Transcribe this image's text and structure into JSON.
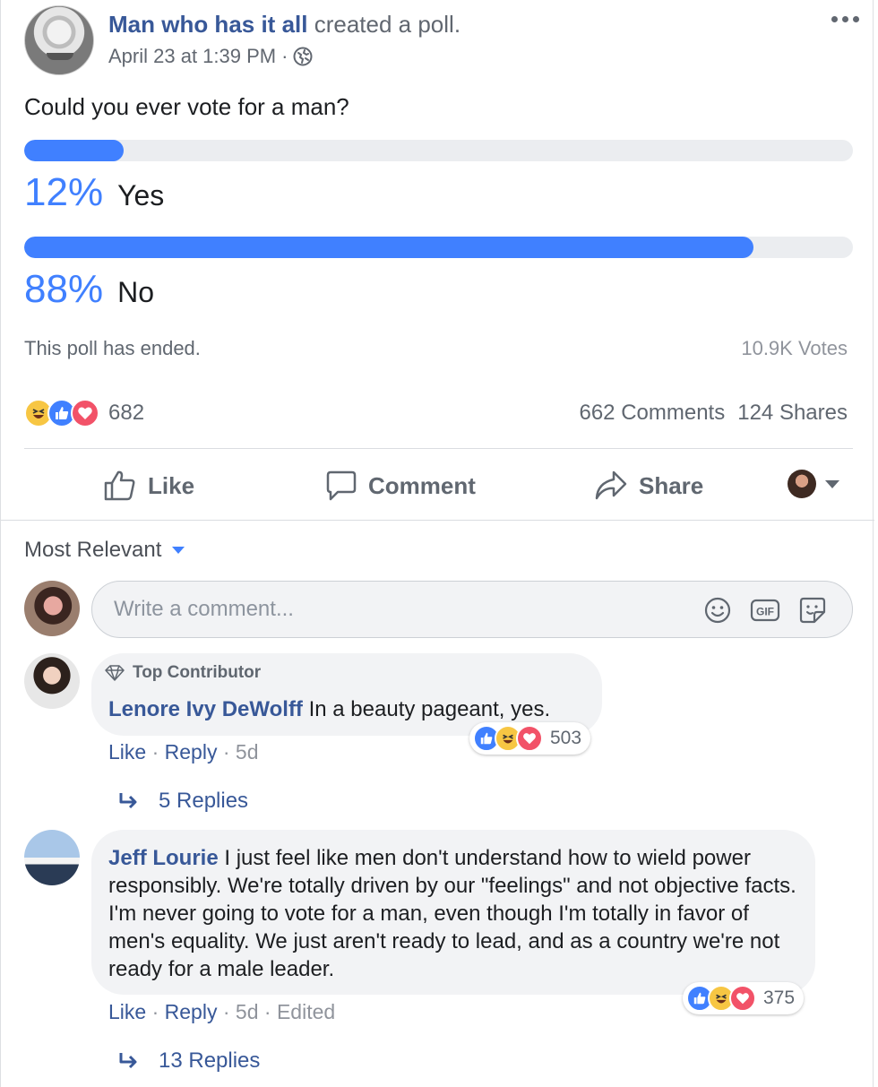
{
  "post": {
    "author": "Man who has it all",
    "action": "created a poll.",
    "timestamp": "April 23 at 1:39 PM",
    "separator": "·",
    "privacy_icon": "globe-icon",
    "question": "Could you ever vote for a man?"
  },
  "poll": {
    "options": [
      {
        "percent_label": "12%",
        "label": "Yes",
        "fraction": 0.12
      },
      {
        "percent_label": "88%",
        "label": "No",
        "fraction": 0.88
      }
    ],
    "status": "This poll has ended.",
    "votes": "10.9K Votes"
  },
  "engagement": {
    "reactions": [
      "haha",
      "like",
      "love"
    ],
    "reaction_count": "682",
    "comments": "662 Comments",
    "shares": "124 Shares"
  },
  "actions": {
    "like": "Like",
    "comment": "Comment",
    "share": "Share"
  },
  "comments_section": {
    "sort_label": "Most Relevant",
    "input_placeholder": "Write a comment...",
    "input_icons": [
      "emoji-icon",
      "gif-icon",
      "sticker-icon"
    ],
    "gif_text": "GIF",
    "items": [
      {
        "badge": "Top Contributor",
        "author": "Lenore Ivy DeWolff",
        "text": "In a beauty pageant, yes.",
        "like": "Like",
        "reply": "Reply",
        "age": "5d",
        "edited": "",
        "reactions": [
          "like",
          "haha",
          "love"
        ],
        "reaction_count": "503",
        "replies": "5 Replies"
      },
      {
        "badge": "",
        "author": "Jeff Lourie",
        "text": "I just feel like men don't understand how to wield power responsibly. We're totally driven by our \"feelings\" and not objective facts. I'm never going to vote for a man, even though I'm totally in favor of men's equality. We just aren't ready to lead, and as a country we're not ready for a male leader.",
        "like": "Like",
        "reply": "Reply",
        "age": "5d",
        "edited": "Edited",
        "reactions": [
          "like",
          "haha",
          "love"
        ],
        "reaction_count": "375",
        "replies": "13 Replies"
      }
    ]
  },
  "colors": {
    "accent": "#4080ff",
    "link": "#385898",
    "muted": "#606770",
    "bubble": "#f2f3f5"
  }
}
